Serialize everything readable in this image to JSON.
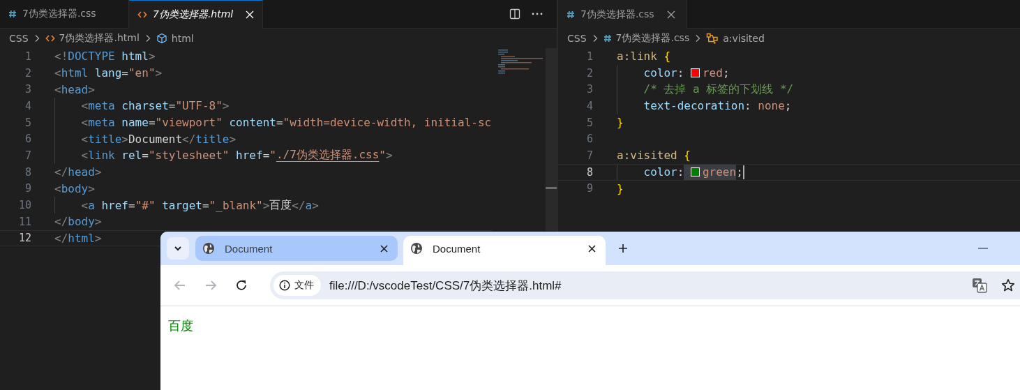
{
  "left_editor": {
    "tabs": [
      {
        "label": "7伪类选择器.css",
        "kind": "css",
        "selected": false,
        "preview": false
      },
      {
        "label": "7伪类选择器.html",
        "kind": "html",
        "selected": true,
        "preview": true
      }
    ],
    "breadcrumbs": [
      {
        "kind": "folder",
        "label": "CSS"
      },
      {
        "kind": "html-file",
        "label": "7伪类选择器.html"
      },
      {
        "kind": "element",
        "label": "html"
      }
    ],
    "lines": [
      {
        "n": "1",
        "current": false,
        "tokens": [
          {
            "kind": "p",
            "t": "<!"
          },
          {
            "kind": "tag",
            "t": "DOCTYPE"
          },
          {
            "kind": "attr",
            "t": " html"
          },
          {
            "kind": "p",
            "t": ">"
          }
        ]
      },
      {
        "n": "2",
        "current": false,
        "tokens": [
          {
            "kind": "p",
            "t": "<"
          },
          {
            "kind": "tag",
            "t": "html"
          },
          {
            "kind": "attr",
            "t": " lang"
          },
          {
            "kind": "eq",
            "t": "="
          },
          {
            "kind": "str",
            "t": "\"en\""
          },
          {
            "kind": "p",
            "t": ">"
          }
        ]
      },
      {
        "n": "3",
        "current": false,
        "tokens": [
          {
            "kind": "p",
            "t": "<"
          },
          {
            "kind": "tag",
            "t": "head"
          },
          {
            "kind": "p",
            "t": ">"
          }
        ]
      },
      {
        "n": "4",
        "current": false,
        "tokens": [
          {
            "kind": "indent"
          },
          {
            "kind": "p",
            "t": "<"
          },
          {
            "kind": "tag",
            "t": "meta"
          },
          {
            "kind": "attr",
            "t": " charset"
          },
          {
            "kind": "eq",
            "t": "="
          },
          {
            "kind": "str",
            "t": "\"UTF-8\""
          },
          {
            "kind": "p",
            "t": ">"
          }
        ]
      },
      {
        "n": "5",
        "current": false,
        "tokens": [
          {
            "kind": "indent"
          },
          {
            "kind": "p",
            "t": "<"
          },
          {
            "kind": "tag",
            "t": "meta"
          },
          {
            "kind": "attr",
            "t": " name"
          },
          {
            "kind": "eq",
            "t": "="
          },
          {
            "kind": "str",
            "t": "\"viewport\""
          },
          {
            "kind": "attr",
            "t": " content"
          },
          {
            "kind": "eq",
            "t": "="
          },
          {
            "kind": "str",
            "t": "\"width=device-width, initial-sc"
          }
        ]
      },
      {
        "n": "6",
        "current": false,
        "tokens": [
          {
            "kind": "indent"
          },
          {
            "kind": "p",
            "t": "<"
          },
          {
            "kind": "tag",
            "t": "title"
          },
          {
            "kind": "p",
            "t": ">"
          },
          {
            "kind": "text",
            "t": "Document"
          },
          {
            "kind": "p",
            "t": "</"
          },
          {
            "kind": "tag",
            "t": "title"
          },
          {
            "kind": "p",
            "t": ">"
          }
        ]
      },
      {
        "n": "7",
        "current": false,
        "tokens": [
          {
            "kind": "indent"
          },
          {
            "kind": "p",
            "t": "<"
          },
          {
            "kind": "tag",
            "t": "link"
          },
          {
            "kind": "attr",
            "t": " rel"
          },
          {
            "kind": "eq",
            "t": "="
          },
          {
            "kind": "str",
            "t": "\"stylesheet\""
          },
          {
            "kind": "attr",
            "t": " href"
          },
          {
            "kind": "eq",
            "t": "="
          },
          {
            "kind": "str",
            "t": "\""
          },
          {
            "kind": "link",
            "t": "./7伪类选择器.css"
          },
          {
            "kind": "str",
            "t": "\""
          },
          {
            "kind": "p",
            "t": ">"
          }
        ]
      },
      {
        "n": "8",
        "current": false,
        "tokens": [
          {
            "kind": "p",
            "t": "</"
          },
          {
            "kind": "tag",
            "t": "head"
          },
          {
            "kind": "p",
            "t": ">"
          }
        ]
      },
      {
        "n": "9",
        "current": false,
        "tokens": [
          {
            "kind": "p",
            "t": "<"
          },
          {
            "kind": "tag",
            "t": "body"
          },
          {
            "kind": "p",
            "t": ">"
          }
        ]
      },
      {
        "n": "10",
        "current": false,
        "tokens": [
          {
            "kind": "indent"
          },
          {
            "kind": "p",
            "t": "<"
          },
          {
            "kind": "tag",
            "t": "a"
          },
          {
            "kind": "attr",
            "t": " href"
          },
          {
            "kind": "eq",
            "t": "="
          },
          {
            "kind": "str",
            "t": "\"#\""
          },
          {
            "kind": "attr",
            "t": " target"
          },
          {
            "kind": "eq",
            "t": "="
          },
          {
            "kind": "str",
            "t": "\"_blank\""
          },
          {
            "kind": "p",
            "t": ">"
          },
          {
            "kind": "text",
            "t": "百度"
          },
          {
            "kind": "p",
            "t": "</"
          },
          {
            "kind": "tag",
            "t": "a"
          },
          {
            "kind": "p",
            "t": ">"
          }
        ]
      },
      {
        "n": "11",
        "current": false,
        "tokens": [
          {
            "kind": "p",
            "t": "</"
          },
          {
            "kind": "tag",
            "t": "body"
          },
          {
            "kind": "p",
            "t": ">"
          }
        ]
      },
      {
        "n": "12",
        "current": true,
        "tokens": [
          {
            "kind": "p",
            "t": "</"
          },
          {
            "kind": "tag",
            "t": "html"
          },
          {
            "kind": "p",
            "t": ">"
          }
        ]
      }
    ]
  },
  "right_editor": {
    "tabs": [
      {
        "label": "7伪类选择器.css",
        "kind": "css",
        "selected": true,
        "preview": false
      }
    ],
    "breadcrumbs": [
      {
        "kind": "folder",
        "label": "CSS"
      },
      {
        "kind": "css-file",
        "label": "7伪类选择器.css"
      },
      {
        "kind": "selector",
        "label": "a:visited"
      }
    ],
    "lines": [
      {
        "n": "1",
        "current": false,
        "tokens": [
          {
            "kind": "sel",
            "t": "a:link"
          },
          {
            "kind": "brace",
            "t": " {"
          }
        ]
      },
      {
        "n": "2",
        "current": false,
        "tokens": [
          {
            "kind": "indent"
          },
          {
            "kind": "prop",
            "t": "color"
          },
          {
            "kind": "text",
            "t": ": "
          },
          {
            "kind": "swatch",
            "color": "#ff0000"
          },
          {
            "kind": "val",
            "t": "red"
          },
          {
            "kind": "text",
            "t": ";"
          }
        ]
      },
      {
        "n": "3",
        "current": false,
        "tokens": [
          {
            "kind": "indent"
          },
          {
            "kind": "comment",
            "t": "/* 去掉 a 标签的下划线 */"
          }
        ]
      },
      {
        "n": "4",
        "current": false,
        "tokens": [
          {
            "kind": "indent"
          },
          {
            "kind": "prop",
            "t": "text-decoration"
          },
          {
            "kind": "text",
            "t": ": "
          },
          {
            "kind": "val",
            "t": "none"
          },
          {
            "kind": "text",
            "t": ";"
          }
        ]
      },
      {
        "n": "5",
        "current": false,
        "tokens": [
          {
            "kind": "brace",
            "t": "}"
          }
        ]
      },
      {
        "n": "6",
        "current": false
      },
      {
        "n": "7",
        "current": false,
        "tokens": [
          {
            "kind": "sel",
            "t": "a:visited"
          },
          {
            "kind": "brace",
            "t": " {"
          }
        ]
      },
      {
        "n": "8",
        "current": true,
        "tokens": [
          {
            "kind": "indent"
          },
          {
            "kind": "prop",
            "t": "color"
          },
          {
            "kind": "text",
            "t": ":"
          },
          {
            "kind": "highlight",
            "children": [
              {
                "kind": "swatch",
                "color": "#008000"
              },
              {
                "kind": "val",
                "t": "green"
              }
            ]
          },
          {
            "kind": "text",
            "t": ";"
          }
        ]
      },
      {
        "n": "9",
        "current": false,
        "tokens": [
          {
            "kind": "brace",
            "t": "}"
          }
        ]
      }
    ]
  },
  "browser": {
    "tabs": [
      {
        "title": "Document",
        "selected": false
      },
      {
        "title": "Document",
        "selected": true
      }
    ],
    "nav": {
      "back_disabled": true,
      "forward_disabled": true
    },
    "address": {
      "chip": "文件",
      "url": "file:///D:/vscodeTest/CSS/7伪类选择器.html#"
    },
    "page": {
      "link": "百度",
      "visited": true
    }
  }
}
